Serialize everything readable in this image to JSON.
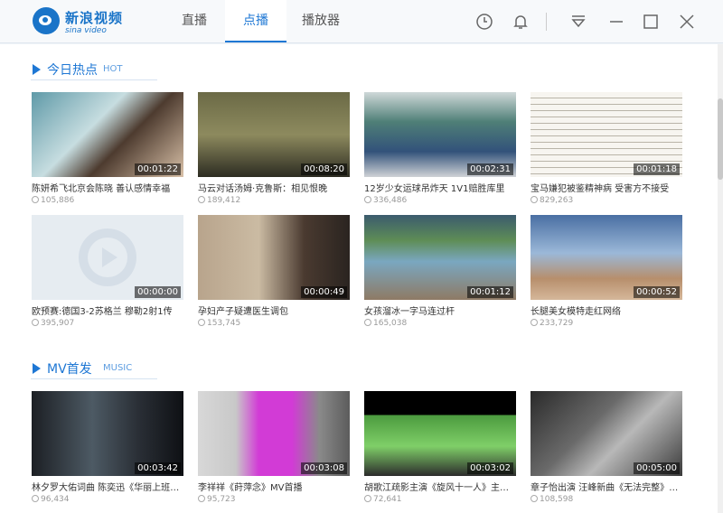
{
  "brand": {
    "name_cn": "新浪视频",
    "name_en": "sina video"
  },
  "tabs": [
    {
      "label": "直播",
      "active": false
    },
    {
      "label": "点播",
      "active": true
    },
    {
      "label": "播放器",
      "active": false
    }
  ],
  "header_icons": [
    "history-icon",
    "bell-icon",
    "dropdown-icon",
    "minimize-icon",
    "maximize-icon",
    "close-icon"
  ],
  "sections": [
    {
      "title": "今日热点",
      "subtitle": "HOT",
      "videos": [
        {
          "title": "陈妍希飞北京会陈晓 善认感情幸福",
          "views": "105,886",
          "duration": "00:01:22"
        },
        {
          "title": "马云对话汤姆·克鲁斯：相见恨晚",
          "views": "189,412",
          "duration": "00:08:20"
        },
        {
          "title": "12岁少女运球吊炸天 1V1赔胜库里",
          "views": "336,486",
          "duration": "00:02:31"
        },
        {
          "title": "宝马嫌犯被鉴精神病 受害方不接受",
          "views": "829,263",
          "duration": "00:01:18"
        },
        {
          "title": "欧预赛:德国3-2苏格兰 穆勒2射1传",
          "views": "395,907",
          "duration": "00:00:00"
        },
        {
          "title": "孕妇产子疑遭医生调包",
          "views": "153,745",
          "duration": "00:00:49"
        },
        {
          "title": "女孩溜冰一字马连过杆",
          "views": "165,038",
          "duration": "00:01:12"
        },
        {
          "title": "长腿美女模特走红网络",
          "views": "233,729",
          "duration": "00:00:52"
        }
      ]
    },
    {
      "title": "MV首发",
      "subtitle": "MUSIC",
      "videos": [
        {
          "title": "林夕罗大佑词曲 陈奕迅《华丽上班族...",
          "views": "96,434",
          "duration": "00:03:42"
        },
        {
          "title": "李祥祥《莳萍念》MV首播",
          "views": "95,723",
          "duration": "00:03:08"
        },
        {
          "title": "胡歌江疏影主演《旋风十一人》主题...",
          "views": "72,641",
          "duration": "00:03:02"
        },
        {
          "title": "章子怡出演 汪峰新曲《无法完整》MV",
          "views": "108,598",
          "duration": "00:05:00"
        }
      ]
    }
  ],
  "colors": {
    "accent": "#1e77d4",
    "header_bg": "#f7f9fb"
  }
}
